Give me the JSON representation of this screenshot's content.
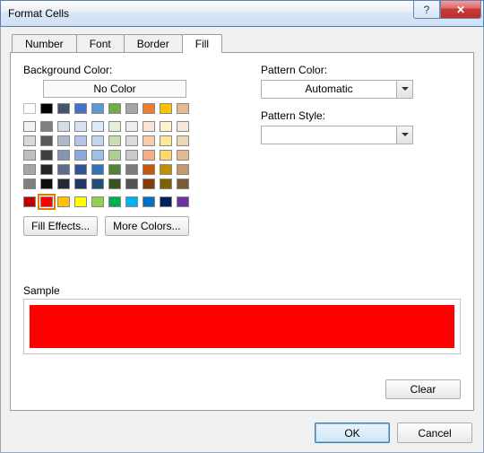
{
  "title": "Format Cells",
  "help_glyph": "?",
  "close_glyph": "✕",
  "tabs": [
    {
      "label": "Number",
      "active": false
    },
    {
      "label": "Font",
      "active": false
    },
    {
      "label": "Border",
      "active": false
    },
    {
      "label": "Fill",
      "active": true
    }
  ],
  "bg_color_label": "Background Color:",
  "no_color_label": "No Color",
  "pattern_color_label": "Pattern Color:",
  "pattern_color_value": "Automatic",
  "pattern_style_label": "Pattern Style:",
  "pattern_style_value": "",
  "fill_effects_label": "Fill Effects...",
  "more_colors_label": "More Colors...",
  "sample_label": "Sample",
  "clear_label": "Clear",
  "ok_label": "OK",
  "cancel_label": "Cancel",
  "selected_color": "#ff0000",
  "palette": {
    "row_header": [
      "#ffffff",
      "#000000",
      "#44546a",
      "#4472c4",
      "#5b9bd5",
      "#70ad47",
      "#a5a5a5",
      "#ed7d31",
      "#ffc000",
      "#e8b98e"
    ],
    "theme_rows": [
      [
        "#f2f2f2",
        "#7f7f7f",
        "#d6dce5",
        "#d9e1f2",
        "#ddebf7",
        "#e2efda",
        "#ededed",
        "#fbe5d6",
        "#fff2cc",
        "#f6e7d8"
      ],
      [
        "#d9d9d9",
        "#595959",
        "#adb9ca",
        "#b4c6e7",
        "#bdd7ee",
        "#c6e0b4",
        "#dbdbdb",
        "#f8cbad",
        "#ffe699",
        "#eed5b6"
      ],
      [
        "#bfbfbf",
        "#404040",
        "#8497b0",
        "#8ea9db",
        "#9bc2e6",
        "#a9d08e",
        "#c9c9c9",
        "#f4b084",
        "#ffd966",
        "#e2bb8f"
      ],
      [
        "#a6a6a6",
        "#262626",
        "#5b6d8a",
        "#305496",
        "#2f75b5",
        "#548235",
        "#7b7b7b",
        "#c65911",
        "#bf8f00",
        "#c49a6c"
      ],
      [
        "#808080",
        "#0d0d0d",
        "#222b35",
        "#203764",
        "#1f4e78",
        "#375623",
        "#525252",
        "#833c0c",
        "#806000",
        "#7a5b36"
      ]
    ],
    "standard": [
      "#c00000",
      "#ff0000",
      "#ffc000",
      "#ffff00",
      "#92d050",
      "#00b050",
      "#00b0f0",
      "#0070c0",
      "#002060",
      "#7030a0"
    ]
  }
}
